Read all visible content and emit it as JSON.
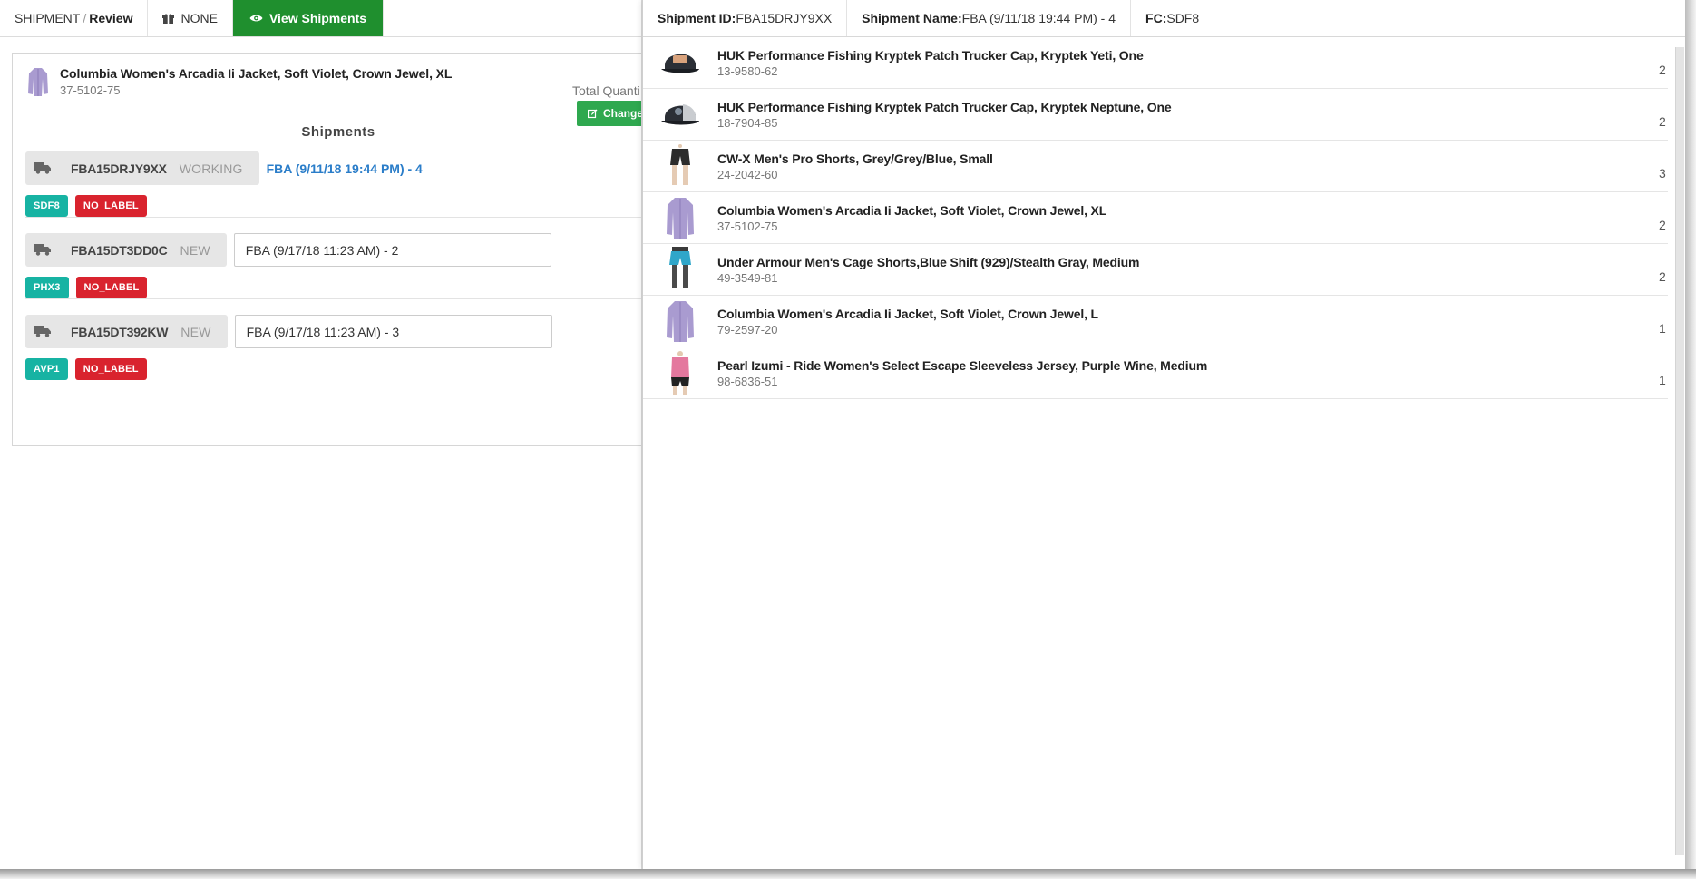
{
  "topbar": {
    "crumb_section": "SHIPMENT",
    "crumb_separator": "/",
    "crumb_current": "Review",
    "none_label": "NONE",
    "view_label": "View Shipments"
  },
  "product": {
    "title": "Columbia Women's Arcadia Ii Jacket, Soft Violet, Crown Jewel, XL",
    "sku": "37-5102-75",
    "total_qty_label": "Total Quanti",
    "change_label": "Change"
  },
  "shipments_title": "Shipments",
  "shipments": [
    {
      "id": "FBA15DRJY9XX",
      "status": "WORKING",
      "name": "FBA (9/11/18 19:44 PM) - 4",
      "fc": "SDF8",
      "label": "NO_LABEL"
    },
    {
      "id": "FBA15DT3DD0C",
      "status": "NEW",
      "name": "FBA (9/17/18 11:23 AM) - 2",
      "fc": "PHX3",
      "label": "NO_LABEL"
    },
    {
      "id": "FBA15DT392KW",
      "status": "NEW",
      "name": "FBA (9/17/18 11:23 AM) - 3",
      "fc": "AVP1",
      "label": "NO_LABEL"
    }
  ],
  "drawer": {
    "id_label": "Shipment ID:",
    "id_value": "FBA15DRJY9XX",
    "name_label": "Shipment Name:",
    "name_value": "FBA (9/11/18 19:44 PM) - 4",
    "fc_label": "FC:",
    "fc_value": "SDF8",
    "items": [
      {
        "name": "HUK Performance Fishing Kryptek Patch Trucker Cap, Kryptek Yeti, One",
        "sku": "13-9580-62",
        "qty": "2",
        "icon": "cap-icon"
      },
      {
        "name": "HUK Performance Fishing Kryptek Patch Trucker Cap, Kryptek Neptune, One",
        "sku": "18-7904-85",
        "qty": "2",
        "icon": "cap-icon"
      },
      {
        "name": "CW-X Men's Pro Shorts, Grey/Grey/Blue, Small",
        "sku": "24-2042-60",
        "qty": "3",
        "icon": "shorts-icon"
      },
      {
        "name": "Columbia Women's Arcadia Ii Jacket, Soft Violet, Crown Jewel, XL",
        "sku": "37-5102-75",
        "qty": "2",
        "icon": "jacket-icon"
      },
      {
        "name": "Under Armour Men's Cage Shorts,Blue Shift (929)/Stealth Gray, Medium",
        "sku": "49-3549-81",
        "qty": "2",
        "icon": "shorts-icon"
      },
      {
        "name": "Columbia Women's Arcadia Ii Jacket, Soft Violet, Crown Jewel, L",
        "sku": "79-2597-20",
        "qty": "1",
        "icon": "jacket-icon"
      },
      {
        "name": "Pearl Izumi - Ride Women's Select Escape Sleeveless Jersey, Purple Wine, Medium",
        "sku": "98-6836-51",
        "qty": "1",
        "icon": "jersey-icon"
      }
    ]
  },
  "colors": {
    "view_button": "#1f8f2e",
    "change_button": "#2fa84f",
    "fc_badge": "#17b3a3",
    "label_badge": "#d9232e",
    "link": "#2a7dc9"
  }
}
